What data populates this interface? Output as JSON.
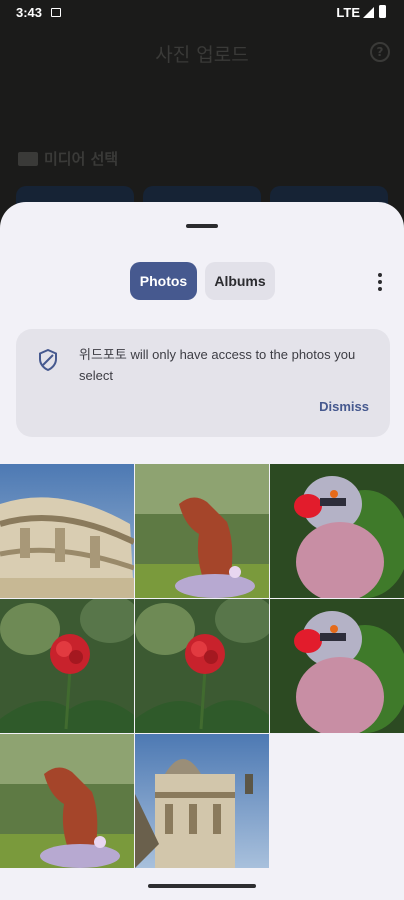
{
  "status_bar": {
    "time": "3:43",
    "network": "LTE"
  },
  "background_app": {
    "title": "사진 업로드",
    "section_label": "미디어 선택"
  },
  "picker": {
    "tabs": [
      {
        "label": "Photos",
        "selected": true
      },
      {
        "label": "Albums",
        "selected": false
      }
    ],
    "banner": {
      "message": "위드포토 will only have access to the photos you select",
      "dismiss_label": "Dismiss"
    },
    "photos": [
      {
        "subject": "dome-building"
      },
      {
        "subject": "red-dog"
      },
      {
        "subject": "parrot"
      },
      {
        "subject": "red-rose"
      },
      {
        "subject": "red-rose"
      },
      {
        "subject": "parrot"
      },
      {
        "subject": "red-dog"
      },
      {
        "subject": "dome-tower"
      }
    ]
  },
  "colors": {
    "accent": "#46598f",
    "sheet_background": "#f2f1f7",
    "banner_background": "#e4e3ea"
  }
}
